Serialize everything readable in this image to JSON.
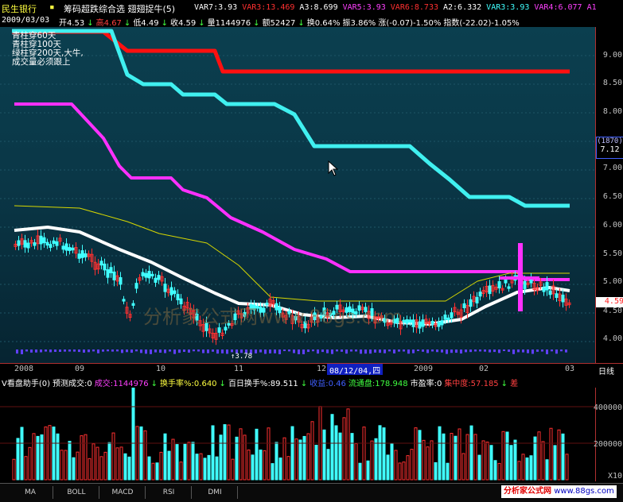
{
  "title": {
    "stock_name": "民生银行",
    "formula_name": "筹码超跌综合选 翅翅捉牛(5)",
    "indicators": [
      {
        "label": "VAR7:3.93",
        "color": "#ffffff"
      },
      {
        "label": "VAR3:13.469",
        "color": "#ff3030"
      },
      {
        "label": "A3:8.699",
        "color": "#ffffff"
      },
      {
        "label": "VAR5:3.93",
        "color": "#ff40ff"
      },
      {
        "label": "VAR6:8.733",
        "color": "#ff3030"
      },
      {
        "label": "A2:6.332",
        "color": "#ffffff"
      },
      {
        "label": "VAR3:3.93",
        "color": "#40ffff"
      },
      {
        "label": "VAR4:6.077",
        "color": "#ff40ff"
      },
      {
        "label": "A1",
        "color": "#ff40ff"
      }
    ]
  },
  "infobar": {
    "date": "2009/03/03",
    "items": [
      {
        "label": "开4.53",
        "color": "#ffffff"
      },
      {
        "label": "↓",
        "color": "#40ff40"
      },
      {
        "label": "高4.67",
        "color": "#ff4040"
      },
      {
        "label": "↓",
        "color": "#40ff40"
      },
      {
        "label": "低4.49",
        "color": "#ffffff"
      },
      {
        "label": "↓",
        "color": "#40ff40"
      },
      {
        "label": "收4.59",
        "color": "#ffffff"
      },
      {
        "label": "↓",
        "color": "#40ff40"
      },
      {
        "label": "量1144976",
        "color": "#ffffff"
      },
      {
        "label": "↓",
        "color": "#40ff40"
      },
      {
        "label": "额52427",
        "color": "#ffffff"
      },
      {
        "label": "↓",
        "color": "#40ff40"
      },
      {
        "label": "换0.64%",
        "color": "#ffffff"
      },
      {
        "label": "振3.86%",
        "color": "#ffffff"
      },
      {
        "label": "涨(-0.07)-1.50%",
        "color": "#ffffff"
      },
      {
        "label": "指数(-22.02)-1.05%",
        "color": "#ffffff"
      }
    ]
  },
  "annotation": {
    "lines": [
      "青柱穿60天",
      "青柱穿100天",
      "绿柱穿200天,大牛,",
      "成交量必须跟上"
    ]
  },
  "price_axis": {
    "labels": [
      "9.00",
      "8.50",
      "8.00",
      "7.50",
      "7.00",
      "6.50",
      "6.00",
      "5.50",
      "5.00",
      "4.50",
      "4.00"
    ],
    "count_label": "(1870)",
    "current_hover": "7.12",
    "current_price": "4.59"
  },
  "low_marker": "3.78",
  "watermark": "分析家公式网www.88gs.com",
  "date_axis": {
    "labels": [
      "2008",
      "09",
      "10",
      "11",
      "12",
      "2009",
      "02",
      "03"
    ],
    "cursor_date": "08/12/04,四",
    "period": "日线"
  },
  "volume_header": {
    "items": [
      {
        "label": "V看盘助手(0)",
        "color": "#ffffff"
      },
      {
        "label": "预测成交:0",
        "color": "#ffffff"
      },
      {
        "label": "成交:1144976",
        "color": "#ff40ff"
      },
      {
        "label": "↓",
        "color": "#40ff40"
      },
      {
        "label": "换手率%:0.640",
        "color": "#ffff40"
      },
      {
        "label": "↓",
        "color": "#40ff40"
      },
      {
        "label": "百日换手%:89.511",
        "color": "#ffffff"
      },
      {
        "label": "↓",
        "color": "#40ff40"
      },
      {
        "label": "收益:0.46",
        "color": "#4060ff"
      },
      {
        "label": "流通盘:178.948",
        "color": "#40ff40"
      },
      {
        "label": "市盈率:0",
        "color": "#ffffff"
      },
      {
        "label": "集中度:57.185",
        "color": "#ff4040"
      },
      {
        "label": "↓",
        "color": "#40ff40"
      },
      {
        "label": "差",
        "color": "#ff4040"
      }
    ]
  },
  "volume_axis": {
    "labels": [
      "400000",
      "200000"
    ],
    "multiplier": "X10"
  },
  "tabs": [
    "MA",
    "BOLL",
    "MACD",
    "RSI",
    "DMI"
  ],
  "footer_brand": "分析家公式网",
  "footer_site": "www.88gs.com",
  "colors": {
    "cyan_line": "#40f0f0",
    "magenta_line": "#ff30ff",
    "red_line": "#ff1010",
    "white_line": "#ffffff",
    "yellow_line": "#d8d800",
    "up_candle": "#ff3030",
    "down_candle": "#40ffff"
  }
}
